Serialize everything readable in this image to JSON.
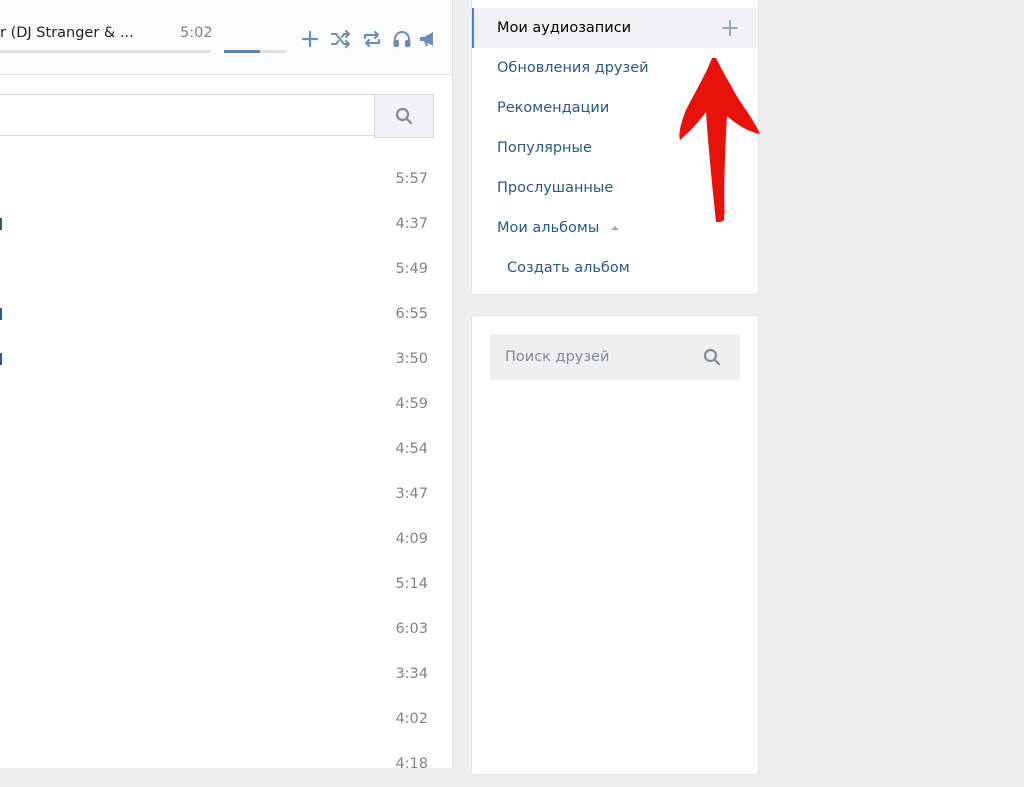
{
  "player": {
    "track_title": "r (DJ Stranger & ...",
    "track_duration": "5:02",
    "volume_fraction": 0.58,
    "controls": [
      "plus-icon",
      "shuffle-icon",
      "repeat-icon",
      "headphones-icon",
      "broadcast-icon"
    ]
  },
  "search": {
    "placeholder": ""
  },
  "tracks": [
    {
      "duration": "5:57"
    },
    {
      "duration": "4:37"
    },
    {
      "duration": "5:49"
    },
    {
      "duration": "6:55"
    },
    {
      "duration": "3:50"
    },
    {
      "duration": "4:59"
    },
    {
      "duration": "4:54"
    },
    {
      "duration": "3:47"
    },
    {
      "duration": "4:09"
    },
    {
      "duration": "5:14"
    },
    {
      "duration": "6:03"
    },
    {
      "duration": "3:34"
    },
    {
      "duration": "4:02"
    },
    {
      "duration": "4:18"
    }
  ],
  "menu": {
    "items": [
      {
        "label": "Мои аудиозаписи"
      },
      {
        "label": "Обновления друзей"
      },
      {
        "label": "Рекомендации"
      },
      {
        "label": "Популярные"
      },
      {
        "label": "Прослушанные"
      },
      {
        "label": "Мои альбомы"
      },
      {
        "label": "Создать альбом"
      }
    ]
  },
  "friends": {
    "search_placeholder": "Поиск друзей"
  },
  "colors": {
    "accent": "#5181b8",
    "link": "#2a5885",
    "background": "#edeef0",
    "arrow": "#e8120c"
  }
}
